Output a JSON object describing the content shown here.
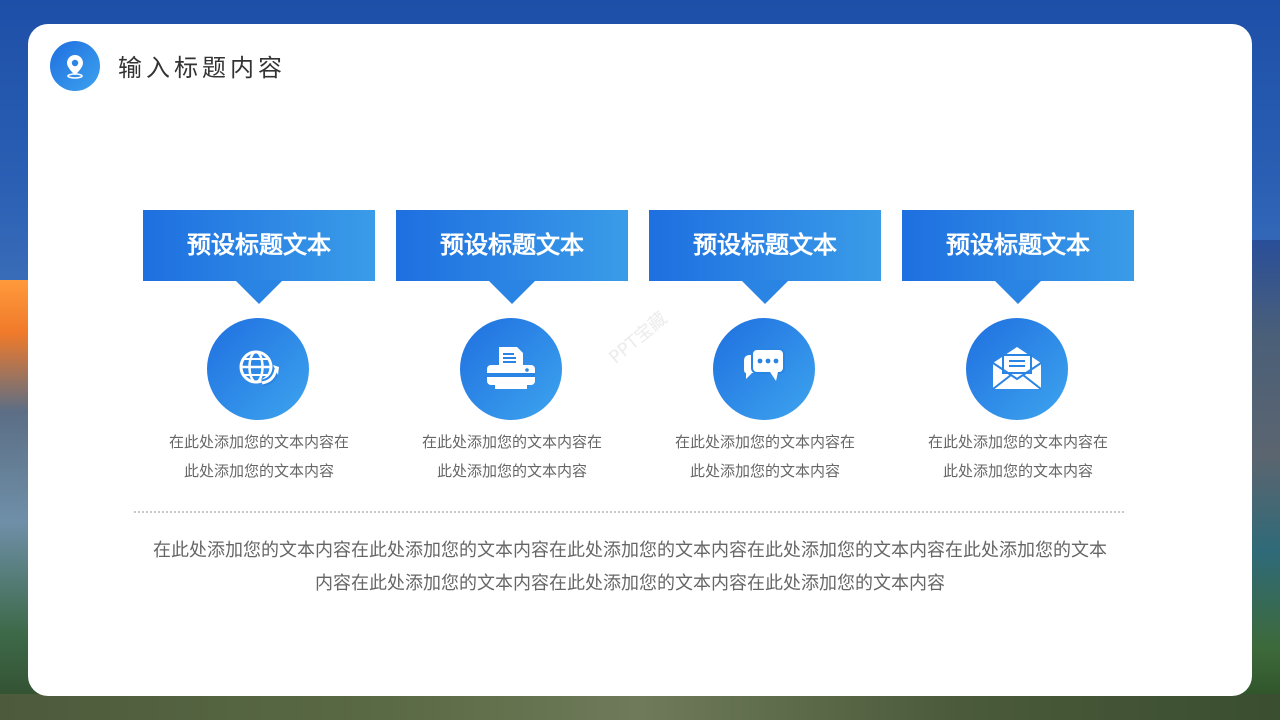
{
  "header": {
    "title": "输入标题内容",
    "logo_icon": "location-pin-icon"
  },
  "steps": [
    {
      "title": "预设标题文本",
      "icon": "globe-refresh-icon",
      "desc_line1": "在此处添加您的文本内容在",
      "desc_line2": "此处添加您的文本内容"
    },
    {
      "title": "预设标题文本",
      "icon": "printer-icon",
      "desc_line1": "在此处添加您的文本内容在",
      "desc_line2": "此处添加您的文本内容"
    },
    {
      "title": "预设标题文本",
      "icon": "chat-bubbles-icon",
      "desc_line1": "在此处添加您的文本内容在",
      "desc_line2": "此处添加您的文本内容"
    },
    {
      "title": "预设标题文本",
      "icon": "envelope-icon",
      "desc_line1": "在此处添加您的文本内容在",
      "desc_line2": "此处添加您的文本内容"
    }
  ],
  "summary": {
    "line1": "在此处添加您的文本内容在此处添加您的文本内容在此处添加您的文本内容在此处添加您的文本内容在此处添加您的文本",
    "line2": "内容在此处添加您的文本内容在此处添加您的文本内容在此处添加您的文本内容"
  },
  "watermark": "PPT宝藏",
  "colors": {
    "accent_start": "#1e6fe0",
    "accent_end": "#3a9ce8",
    "card_bg": "#ffffff",
    "text_dark": "#333333",
    "text_body": "#666666"
  }
}
